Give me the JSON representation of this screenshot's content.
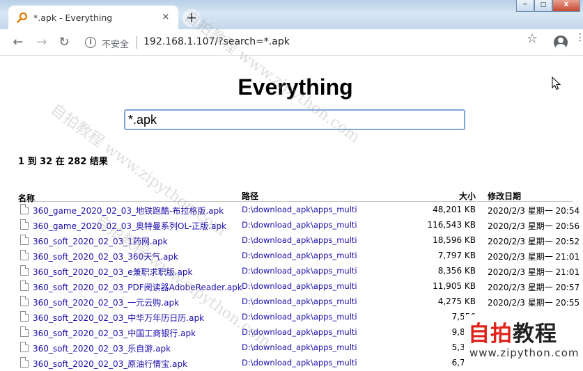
{
  "browser": {
    "tab_title": "*.apk - Everything",
    "tab_close": "×",
    "new_tab": "+",
    "window_controls": [
      "─",
      "□",
      "X"
    ],
    "nav_back": "←",
    "nav_forward": "→",
    "nav_reload": "↻",
    "security_label": "不安全",
    "url": "192.168.1.107/?search=*.apk",
    "bookmark_icon": "☆",
    "menu_icon": "⋮"
  },
  "page": {
    "heading": "Everything",
    "search_value": "*.apk",
    "result_summary": "1 到 32 在 282 结果",
    "columns": {
      "name": "名称",
      "path": "路径",
      "size": "大小",
      "date": "修改日期"
    },
    "rows": [
      {
        "name": "360_game_2020_02_03_地铁跑酷-布拉格版.apk",
        "path": "D:\\download_apk\\apps_multi",
        "size": "48,201 KB",
        "date": "2020/2/3 星期一 20:54"
      },
      {
        "name": "360_game_2020_02_03_奥特曼系列OL-正版.apk",
        "path": "D:\\download_apk\\apps_multi",
        "size": "116,543 KB",
        "date": "2020/2/3 星期一 20:56"
      },
      {
        "name": "360_soft_2020_02_03_1药网.apk",
        "path": "D:\\download_apk\\apps_multi",
        "size": "18,596 KB",
        "date": "2020/2/3 星期一 20:52"
      },
      {
        "name": "360_soft_2020_02_03_360天气.apk",
        "path": "D:\\download_apk\\apps_multi",
        "size": "7,797 KB",
        "date": "2020/2/3 星期一 21:01"
      },
      {
        "name": "360_soft_2020_02_03_e兼职求职版.apk",
        "path": "D:\\download_apk\\apps_multi",
        "size": "8,356 KB",
        "date": "2020/2/3 星期一 21:01"
      },
      {
        "name": "360_soft_2020_02_03_PDF阅读器AdobeReader.apk",
        "path": "D:\\download_apk\\apps_multi",
        "size": "11,905 KB",
        "date": "2020/2/3 星期一 20:57"
      },
      {
        "name": "360_soft_2020_02_03_一元云购.apk",
        "path": "D:\\download_apk\\apps_multi",
        "size": "4,275 KB",
        "date": "2020/2/3 星期一 20:55"
      },
      {
        "name": "360_soft_2020_02_03_中华万年历日历.apk",
        "path": "D:\\download_apk\\apps_multi",
        "size": "7,556",
        "date": ""
      },
      {
        "name": "360_soft_2020_02_03_中国工商银行.apk",
        "path": "D:\\download_apk\\apps_multi",
        "size": "9,865",
        "date": ""
      },
      {
        "name": "360_soft_2020_02_03_乐自游.apk",
        "path": "D:\\download_apk\\apps_multi",
        "size": "5,382",
        "date": ""
      },
      {
        "name": "360_soft_2020_02_03_原油行情宝.apk",
        "path": "D:\\download_apk\\apps_multi",
        "size": "6,746",
        "date": ""
      }
    ]
  },
  "overlay": {
    "watermarks": [
      "自拍教程 www.zipython.com",
      "自拍教程 www.zipython.com",
      "自拍教程 www.zipython.com"
    ],
    "brand_red": "自拍",
    "brand_dark": "教程",
    "brand_url": "www.zipython.com"
  }
}
